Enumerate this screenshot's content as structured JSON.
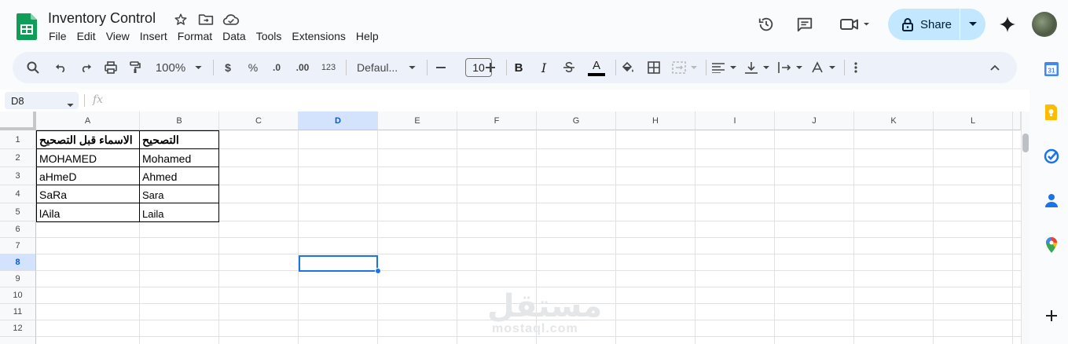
{
  "doc": {
    "title": "Inventory Control"
  },
  "menu": [
    "File",
    "Edit",
    "View",
    "Insert",
    "Format",
    "Data",
    "Tools",
    "Extensions",
    "Help"
  ],
  "share": {
    "label": "Share"
  },
  "toolbar": {
    "zoom": "100%",
    "currency": "$",
    "percent": "%",
    "dec_decrease": ".0",
    "dec_increase": ".00",
    "number_format": "123",
    "font": "Defaul...",
    "font_size": "10",
    "bold": "B",
    "italic": "I",
    "text_color_letter": "A",
    "text_color_bar": "#000000"
  },
  "formula": {
    "cell_ref": "D8",
    "fx": "fx",
    "value": ""
  },
  "grid": {
    "columns": [
      "A",
      "B",
      "C",
      "D",
      "E",
      "F",
      "G",
      "H",
      "I",
      "J",
      "K",
      "L"
    ],
    "rows": [
      "1",
      "2",
      "3",
      "4",
      "5",
      "6",
      "7",
      "8",
      "9",
      "10",
      "11",
      "12"
    ],
    "selected_column": "D",
    "selected_row": "8",
    "selected_cell": "D8",
    "cells": {
      "A1": "الاسماء قبل التصحيح",
      "B1": "التصحيح",
      "A2": "MOHAMED",
      "B2": "Mohamed",
      "A3": "aHmeD",
      "B3": "Ahmed",
      "A4": "SaRa",
      "B4": "Sara",
      "A5": "lAila",
      "B5": "Laila"
    }
  },
  "watermark": {
    "arabic": "مستقل",
    "latin": "mostaql.com"
  },
  "colors": {
    "accent": "#0b57d0",
    "share_bg": "#c2e7ff",
    "sheets_green": "#0f9d58",
    "selection": "#1a73e8"
  }
}
